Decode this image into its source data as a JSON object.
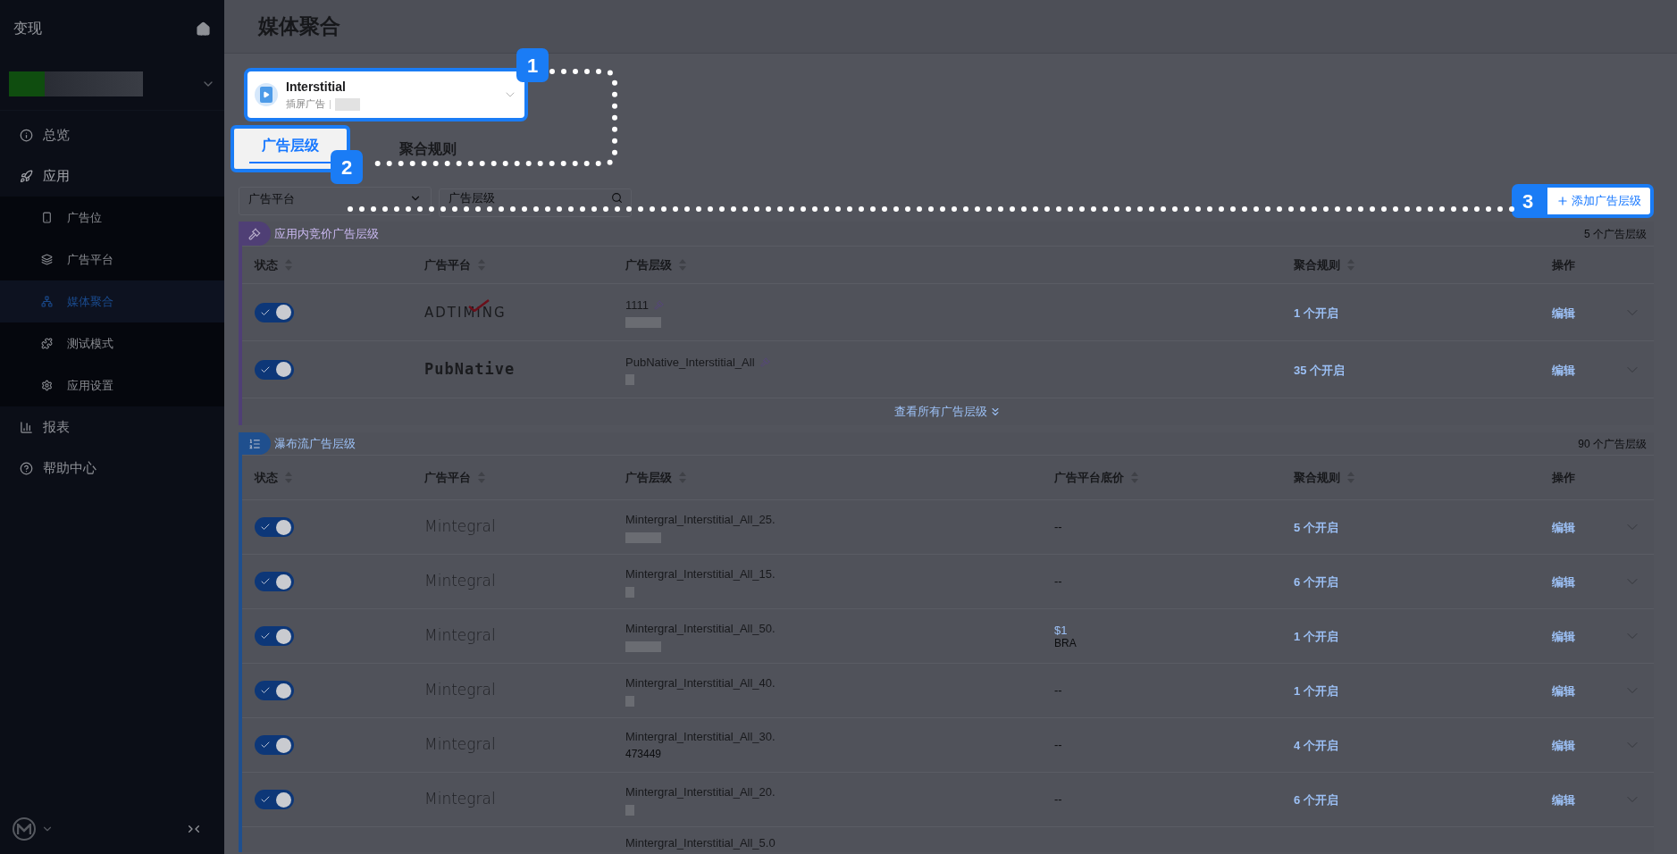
{
  "sidebar": {
    "title": "变现",
    "items": [
      {
        "label": "总览",
        "selected": false
      },
      {
        "label": "应用",
        "selected": false,
        "expanded": true,
        "children": [
          {
            "label": "广告位",
            "selected": false
          },
          {
            "label": "广告平台",
            "selected": false
          },
          {
            "label": "媒体聚合",
            "selected": true
          },
          {
            "label": "测试模式",
            "selected": false
          },
          {
            "label": "应用设置",
            "selected": false
          }
        ]
      },
      {
        "label": "报表",
        "selected": false
      },
      {
        "label": "帮助中心",
        "selected": false
      }
    ]
  },
  "page": {
    "title": "媒体聚合"
  },
  "placement": {
    "name": "Interstitial",
    "type": "插屏广告"
  },
  "tabs": [
    {
      "label": "广告层级",
      "selected": true
    },
    {
      "label": "聚合规则",
      "selected": false
    }
  ],
  "filters": {
    "platform_select": {
      "placeholder": "广告平台"
    },
    "layer_search": {
      "placeholder": "广告层级"
    }
  },
  "add_button": "添加广告层级",
  "callouts": [
    "1",
    "2",
    "3"
  ],
  "bidding": {
    "title": "应用内竞价广告层级",
    "count": "5 个广告层级",
    "columns": [
      {
        "label": "状态",
        "sortable": true
      },
      {
        "label": "广告平台",
        "sortable": true
      },
      {
        "label": "广告层级",
        "sortable": true
      },
      {
        "label": "聚合规则",
        "sortable": true
      },
      {
        "label": "操作",
        "sortable": false
      }
    ],
    "rows": [
      {
        "enabled": true,
        "platform": "ADTIMING",
        "kind": "adtiming",
        "layer": "1111",
        "rules": "1 个开启",
        "action": "编辑"
      },
      {
        "enabled": true,
        "platform": "PubNative",
        "kind": "pubnative",
        "layer": "PubNative_Interstitial_All",
        "rules": "35 个开启",
        "action": "编辑"
      }
    ],
    "more_link": "查看所有广告层级"
  },
  "waterfall": {
    "title": "瀑布流广告层级",
    "count": "90 个广告层级",
    "columns": [
      {
        "label": "状态",
        "sortable": true
      },
      {
        "label": "广告平台",
        "sortable": true
      },
      {
        "label": "广告层级",
        "sortable": true
      },
      {
        "label": "广告平台底价",
        "sortable": true
      },
      {
        "label": "聚合规则",
        "sortable": true
      },
      {
        "label": "操作",
        "sortable": false
      }
    ],
    "rows": [
      {
        "enabled": true,
        "platform": "Mintegral",
        "kind": "mintegral",
        "layer": "Mintergral_Interstitial_All_25.",
        "floor": {
          "kind": "none",
          "text": "--"
        },
        "rules": "5 个开启",
        "action": "编辑"
      },
      {
        "enabled": true,
        "platform": "Mintegral",
        "kind": "mintegral",
        "layer": "Mintergral_Interstitial_All_15.",
        "floor": {
          "kind": "none",
          "text": "--"
        },
        "rules": "6 个开启",
        "action": "编辑"
      },
      {
        "enabled": true,
        "platform": "Mintegral",
        "kind": "mintegral",
        "layer": "Mintergral_Interstitial_All_50.",
        "floor": {
          "kind": "price",
          "text": "$1",
          "country": "BRA"
        },
        "rules": "1 个开启",
        "action": "编辑"
      },
      {
        "enabled": true,
        "platform": "Mintegral",
        "kind": "mintegral",
        "layer": "Mintergral_Interstitial_All_40.",
        "floor": {
          "kind": "none",
          "text": "--"
        },
        "rules": "1 个开启",
        "action": "编辑"
      },
      {
        "enabled": true,
        "platform": "Mintegral",
        "kind": "mintegral",
        "layer": "Mintergral_Interstitial_All_30.",
        "layer_id": "473449",
        "floor": {
          "kind": "none",
          "text": "--"
        },
        "rules": "4 个开启",
        "action": "编辑"
      },
      {
        "enabled": true,
        "platform": "Mintegral",
        "kind": "mintegral",
        "layer": "Mintergral_Interstitial_All_20.",
        "floor": {
          "kind": "none",
          "text": "--"
        },
        "rules": "6 个开启",
        "action": "编辑"
      }
    ],
    "partial_row": {
      "layer": "Mintergral_Interstitial_All_5.0"
    }
  }
}
